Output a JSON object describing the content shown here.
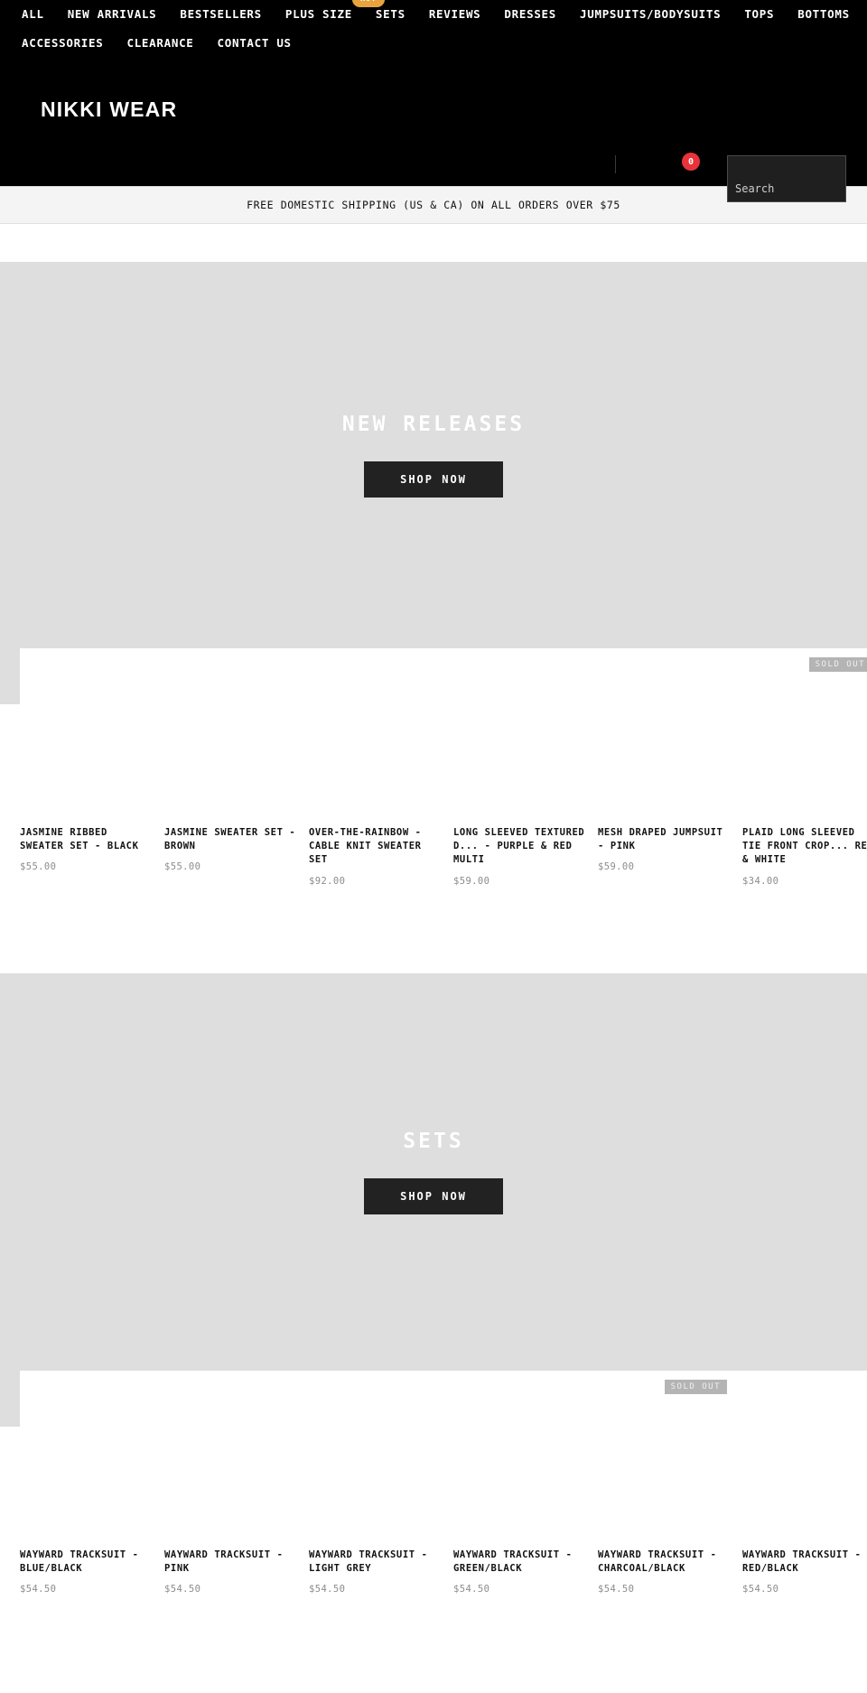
{
  "nav": {
    "promo_pill": "HOT",
    "row1": [
      {
        "label": "ALL"
      },
      {
        "label": "NEW ARRIVALS"
      },
      {
        "label": "BESTSELLERS"
      },
      {
        "label": "PLUS SIZE"
      },
      {
        "label": "SETS"
      },
      {
        "label": "REVIEWS"
      },
      {
        "label": "DRESSES"
      },
      {
        "label": "JUMPSUITS/BODYSUITS"
      },
      {
        "label": "TOPS"
      },
      {
        "label": "BOTTOMS"
      }
    ],
    "row2": [
      {
        "label": "ACCESSORIES"
      },
      {
        "label": "CLEARANCE"
      },
      {
        "label": "CONTACT US"
      }
    ]
  },
  "header": {
    "logo": "NIKKI WEAR",
    "cart_count": "0",
    "search_placeholder": "Search",
    "search_value": ""
  },
  "announcement": {
    "text": "FREE DOMESTIC SHIPPING (US & CA) ON ALL ORDERS OVER $75"
  },
  "sections": [
    {
      "hero_title": "NEW RELEASES",
      "hero_button": "SHOP NOW",
      "products": [
        {
          "title": "JASMINE RIBBED SWEATER SET - BLACK",
          "price": "$55.00",
          "sold_out": ""
        },
        {
          "title": "JASMINE SWEATER SET - BROWN",
          "price": "$55.00",
          "sold_out": ""
        },
        {
          "title": "OVER-THE-RAINBOW - CABLE KNIT SWEATER SET",
          "price": "$92.00",
          "sold_out": ""
        },
        {
          "title": "LONG SLEEVED TEXTURED D... - PURPLE & RED MULTI",
          "price": "$59.00",
          "sold_out": ""
        },
        {
          "title": "MESH DRAPED JUMPSUIT - PINK",
          "price": "$59.00",
          "sold_out": ""
        },
        {
          "title": "PLAID LONG SLEEVED TIE FRONT CROP... RED & WHITE",
          "price": "$34.00",
          "sold_out": "SOLD OUT"
        }
      ]
    },
    {
      "hero_title": "SETS",
      "hero_button": "SHOP NOW",
      "products": [
        {
          "title": "WAYWARD TRACKSUIT - BLUE/BLACK",
          "price": "$54.50",
          "sold_out": ""
        },
        {
          "title": "WAYWARD TRACKSUIT - PINK",
          "price": "$54.50",
          "sold_out": ""
        },
        {
          "title": "WAYWARD TRACKSUIT - LIGHT GREY",
          "price": "$54.50",
          "sold_out": ""
        },
        {
          "title": "WAYWARD TRACKSUIT - GREEN/BLACK",
          "price": "$54.50",
          "sold_out": ""
        },
        {
          "title": "WAYWARD TRACKSUIT - CHARCOAL/BLACK",
          "price": "$54.50",
          "sold_out": "SOLD OUT"
        },
        {
          "title": "WAYWARD TRACKSUIT - RED/BLACK",
          "price": "$54.50",
          "sold_out": ""
        }
      ]
    }
  ],
  "colors": {
    "bg_dark": "#000000",
    "accent_red": "#e8333a",
    "accent_orange": "#e8a33d",
    "hero_bg": "#dedede",
    "button_dark": "#222222"
  }
}
